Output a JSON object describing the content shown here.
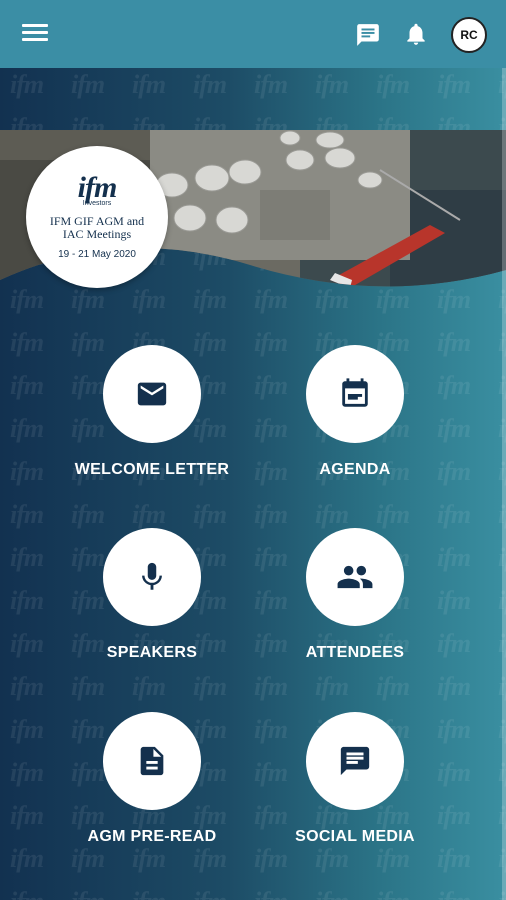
{
  "app_bar": {
    "menu_icon": "hamburger-menu-icon",
    "chat_icon": "chat-icon",
    "notifications_icon": "bell-icon",
    "user_initials": "RC",
    "color": "#3b8ea5"
  },
  "watermark_text": "ifm",
  "banner": {
    "logo_text": "ifm",
    "logo_subtext": "Investors",
    "event_title": "IFM GIF AGM and IAC Meetings",
    "event_dates": "19 - 21 May 2020"
  },
  "tiles": [
    {
      "label": "WELCOME LETTER",
      "icon": "envelope-icon"
    },
    {
      "label": "AGENDA",
      "icon": "calendar-note-icon"
    },
    {
      "label": "SPEAKERS",
      "icon": "microphone-icon"
    },
    {
      "label": "ATTENDEES",
      "icon": "people-icon"
    },
    {
      "label": "AGM PRE-READ",
      "icon": "document-icon"
    },
    {
      "label": "SOCIAL MEDIA",
      "icon": "message-icon"
    }
  ],
  "colors": {
    "background_start": "#123150",
    "background_end": "#3a8fa1",
    "icon_color": "#14304d"
  }
}
